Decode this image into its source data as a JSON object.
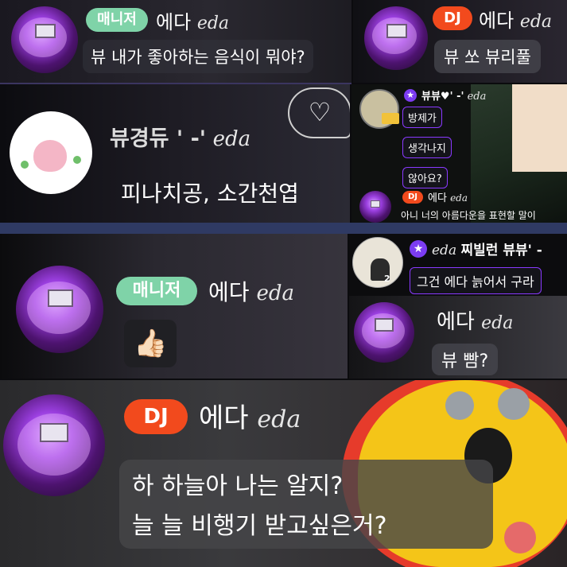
{
  "panel1": {
    "badge": "매니저",
    "nick": "에다",
    "script": "eda",
    "message": "뷰 내가 좋아하는 음식이 뭐야?"
  },
  "panel2": {
    "badge": "DJ",
    "nick": "에다",
    "script": "eda",
    "message": "뷰 쏘 뷰리풀"
  },
  "panel3": {
    "nick": "뷰경듀 ' -'",
    "script": "eda",
    "message": "피나치공, 소간천엽",
    "sticker_text": "♡"
  },
  "panel4": {
    "nick": "뷰뷰♥' -'",
    "script": "eda",
    "bubbles": [
      "방제가",
      "생각나지",
      "않아요?"
    ],
    "dj_badge": "DJ",
    "dj_nick": "에다",
    "dj_script": "eda",
    "dj_message": "아니 너의 아름다운을 표현할 말이"
  },
  "panel5": {
    "badge": "매니저",
    "nick": "에다",
    "script": "eda",
    "emoji": "👍🏻"
  },
  "panel6": {
    "top_script": "eda",
    "top_nick": "찌빌런 뷰뷰' -",
    "top_message": "그건 에다 늙어서 구라",
    "avatar_num": "2",
    "nick": "에다",
    "script": "eda",
    "message": "뷰 빰?"
  },
  "panel7": {
    "badge": "DJ",
    "nick": "에다",
    "script": "eda",
    "line1": "하 하늘아 나는 알지?",
    "line2": "늘 늘 비행기 받고싶은거?"
  },
  "colors": {
    "manager": "#7fd3a8",
    "dj": "#f24a1d",
    "accent": "#8a39ff",
    "bubble": "#46464e"
  }
}
